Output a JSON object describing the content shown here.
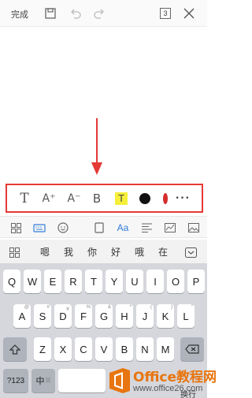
{
  "topbar": {
    "done_label": "完成",
    "page_count": "3"
  },
  "format_toolbar": {
    "items": [
      {
        "name": "text-style",
        "label": "T"
      },
      {
        "name": "increase-font",
        "label": "A⁺"
      },
      {
        "name": "decrease-font",
        "label": "A⁻"
      },
      {
        "name": "bold",
        "label": "B"
      },
      {
        "name": "highlight",
        "label": "T",
        "color": "#f5ef3a"
      },
      {
        "name": "font-color",
        "color": "#111111"
      },
      {
        "name": "color-partial",
        "color": "#d32f2f"
      },
      {
        "name": "more",
        "label": "•••"
      }
    ],
    "highlight_color": "#e53935"
  },
  "icon_row": [
    "grid-icon",
    "keyboard-icon",
    "emoji-icon",
    "page-icon",
    "font-icon",
    "align-icon",
    "chart-icon",
    "image-icon"
  ],
  "candidates": [
    "嗯",
    "我",
    "你",
    "好",
    "哦",
    "在"
  ],
  "keyboard": {
    "row1": [
      "Q",
      "W",
      "E",
      "R",
      "T",
      "Y",
      "U",
      "I",
      "O",
      "P"
    ],
    "row2": [
      "A",
      "S",
      "D",
      "F",
      "G",
      "H",
      "J",
      "K",
      "L"
    ],
    "row3": [
      "Z",
      "X",
      "C",
      "V",
      "B",
      "N",
      "M"
    ],
    "row2_sup": [
      "@",
      "#",
      "￥",
      "%",
      "&",
      "*",
      "(",
      ")",
      "\""
    ],
    "sym_label": "?123",
    "lang_label": "中",
    "lang_sub": "英",
    "enter_label": "换行"
  },
  "watermark": {
    "text": "Office教程网",
    "url": "www.office26.com",
    "color": "#e8750f"
  }
}
